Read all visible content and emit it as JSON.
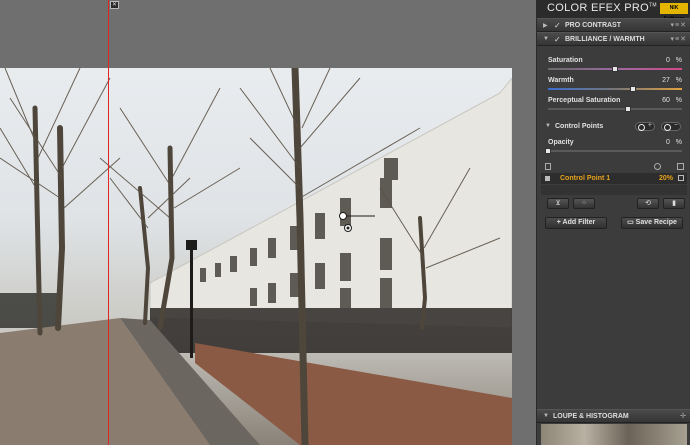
{
  "app": {
    "title": "COLOR EFEX PRO",
    "tm": "TM",
    "version": "4",
    "logo_text": "NIK Software"
  },
  "filters": [
    {
      "name": "PRO CONTRAST",
      "checked": true,
      "expanded": false
    },
    {
      "name": "BRILLIANCE / WARMTH",
      "checked": true,
      "expanded": true
    }
  ],
  "sliders": {
    "saturation": {
      "label": "Saturation",
      "value": "0",
      "unit": "%",
      "fraction": 0.5
    },
    "warmth": {
      "label": "Warmth",
      "value": "27",
      "unit": "%",
      "fraction": 0.635
    },
    "perceptual": {
      "label": "Perceptual Saturation",
      "value": "60",
      "unit": "%",
      "fraction": 0.6
    },
    "opacity": {
      "label": "Opacity",
      "value": "0",
      "unit": "%",
      "fraction": 0.0
    }
  },
  "control_points": {
    "label": "Control Points",
    "items": [
      {
        "name": "Control Point 1",
        "percent": "20%"
      }
    ]
  },
  "buttons": {
    "add_filter": "Add Filter",
    "save_recipe": "Save Recipe"
  },
  "loupe": {
    "label": "LOUPE & HISTOGRAM"
  },
  "colors": {
    "accent": "#e6a21a",
    "guide": "#e02424",
    "panel_bg": "#3c3c3c"
  },
  "icons": {
    "filter_arrow": "triangle-right",
    "check": "checkmark",
    "close": "x"
  }
}
